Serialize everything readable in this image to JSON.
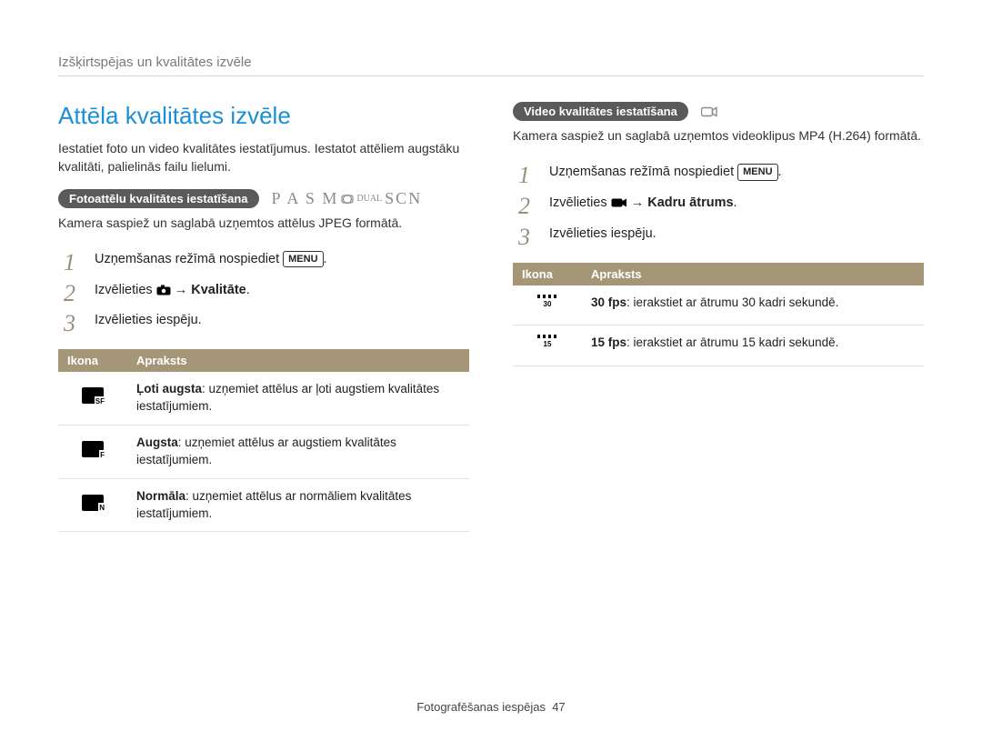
{
  "breadcrumb": "Izšķirtspējas un kvalitātes izvēle",
  "title": "Attēla kvalitātes izvēle",
  "intro": "Iestatiet foto un video kvalitātes iestatījumus. Iestatot attēliem augstāku kvalitāti, palielinās failu lielumi.",
  "photo": {
    "pill": "Fotoattēlu kvalitātes iestatīšana",
    "modes_text": "P A S M",
    "modes_dual": "DUAL",
    "modes_scn": "SCN",
    "desc": "Kamera saspiež un saglabā uzņemtos attēlus JPEG formātā.",
    "step1_a": "Uzņemšanas režīmā nospiediet ",
    "step1_menu": "MENU",
    "step1_b": ".",
    "step2_a": "Izvēlieties ",
    "step2_arrow": " → ",
    "step2_b": "Kvalitāte",
    "step2_c": ".",
    "step3": "Izvēlieties iespēju.",
    "th_icon": "Ikona",
    "th_desc": "Apraksts",
    "rows": [
      {
        "icon_lbl": "SF",
        "name": "Ļoti augsta",
        "desc": ": uzņemiet attēlus ar ļoti augstiem kvalitātes iestatījumiem."
      },
      {
        "icon_lbl": "F",
        "name": "Augsta",
        "desc": ": uzņemiet attēlus ar augstiem kvalitātes iestatījumiem."
      },
      {
        "icon_lbl": "N",
        "name": "Normāla",
        "desc": ": uzņemiet attēlus ar normāliem kvalitātes iestatījumiem."
      }
    ]
  },
  "video": {
    "pill": "Video kvalitātes iestatīšana",
    "desc": "Kamera saspiež un saglabā uzņemtos videoklipus MP4 (H.264) formātā.",
    "step1_a": "Uzņemšanas režīmā nospiediet ",
    "step1_menu": "MENU",
    "step1_b": ".",
    "step2_a": "Izvēlieties ",
    "step2_arrow": " → ",
    "step2_b": "Kadru ātrums",
    "step2_c": ".",
    "step3": "Izvēlieties iespēju.",
    "th_icon": "Ikona",
    "th_desc": "Apraksts",
    "rows": [
      {
        "icon_lbl": "30",
        "name": "30 fps",
        "desc": ": ierakstiet ar ātrumu 30 kadri sekundē."
      },
      {
        "icon_lbl": "15",
        "name": "15 fps",
        "desc": ": ierakstiet ar ātrumu 15 kadri sekundē."
      }
    ]
  },
  "footer_text": "Fotografēšanas iespējas",
  "footer_page": "47"
}
